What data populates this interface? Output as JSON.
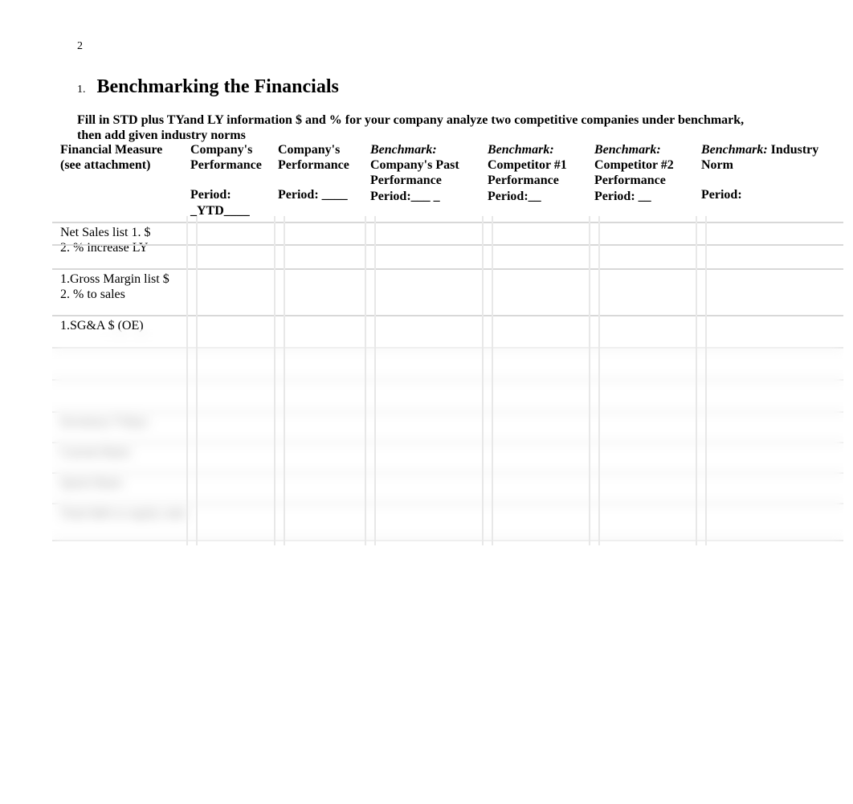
{
  "page_number": "2",
  "heading": {
    "number": "1.",
    "text": "Benchmarking the Financials"
  },
  "instructions_line1": "Fill in  STD plus TYand LY information $ and %  for your company analyze two competitive companies under benchmark,",
  "instructions_line2": "then add given industry norms",
  "columns": {
    "measure": {
      "title": "Financial Measure",
      "subtitle": "(see attachment)"
    },
    "perf1": {
      "title": "Company's Performance",
      "period_label": "Period: _YTD____"
    },
    "perf2": {
      "title": "Company's Performance",
      "period_label": "Period: ____"
    },
    "bench1": {
      "label": "Benchmark:",
      "text": "Company's Past Performance",
      "period": "Period:___ _"
    },
    "bench2": {
      "label": "Benchmark:",
      "text": "Competitor #1 Performance",
      "period": "Period:__"
    },
    "bench3": {
      "label": "Benchmark:",
      "text": "Competitor #2 Performance",
      "period": "Period: __"
    },
    "bench4": {
      "label": "Benchmark:",
      "text": "Industry Norm",
      "period": "Period:"
    }
  },
  "rows": [
    {
      "line1": "Net Sales list 1. $",
      "line2": "2.   %  increase LY"
    },
    {
      "line1": "1.Gross Margin list  $",
      "line2": " 2. % to sales"
    },
    {
      "line1": "1.SG&A $  (OE)",
      "line2": ""
    },
    {
      "line1": "",
      "line2": ""
    },
    {
      "line1": "",
      "line2": ""
    },
    {
      "line1": "Inventory T/days",
      "line2": "",
      "blurred": true
    },
    {
      "line1": "Current Ratio",
      "line2": "",
      "blurred": true
    },
    {
      "line1": "Quick Ratio",
      "line2": "",
      "blurred": true
    },
    {
      "line1": "Total debt to equity ratio",
      "line2": "",
      "blurred": true
    }
  ]
}
